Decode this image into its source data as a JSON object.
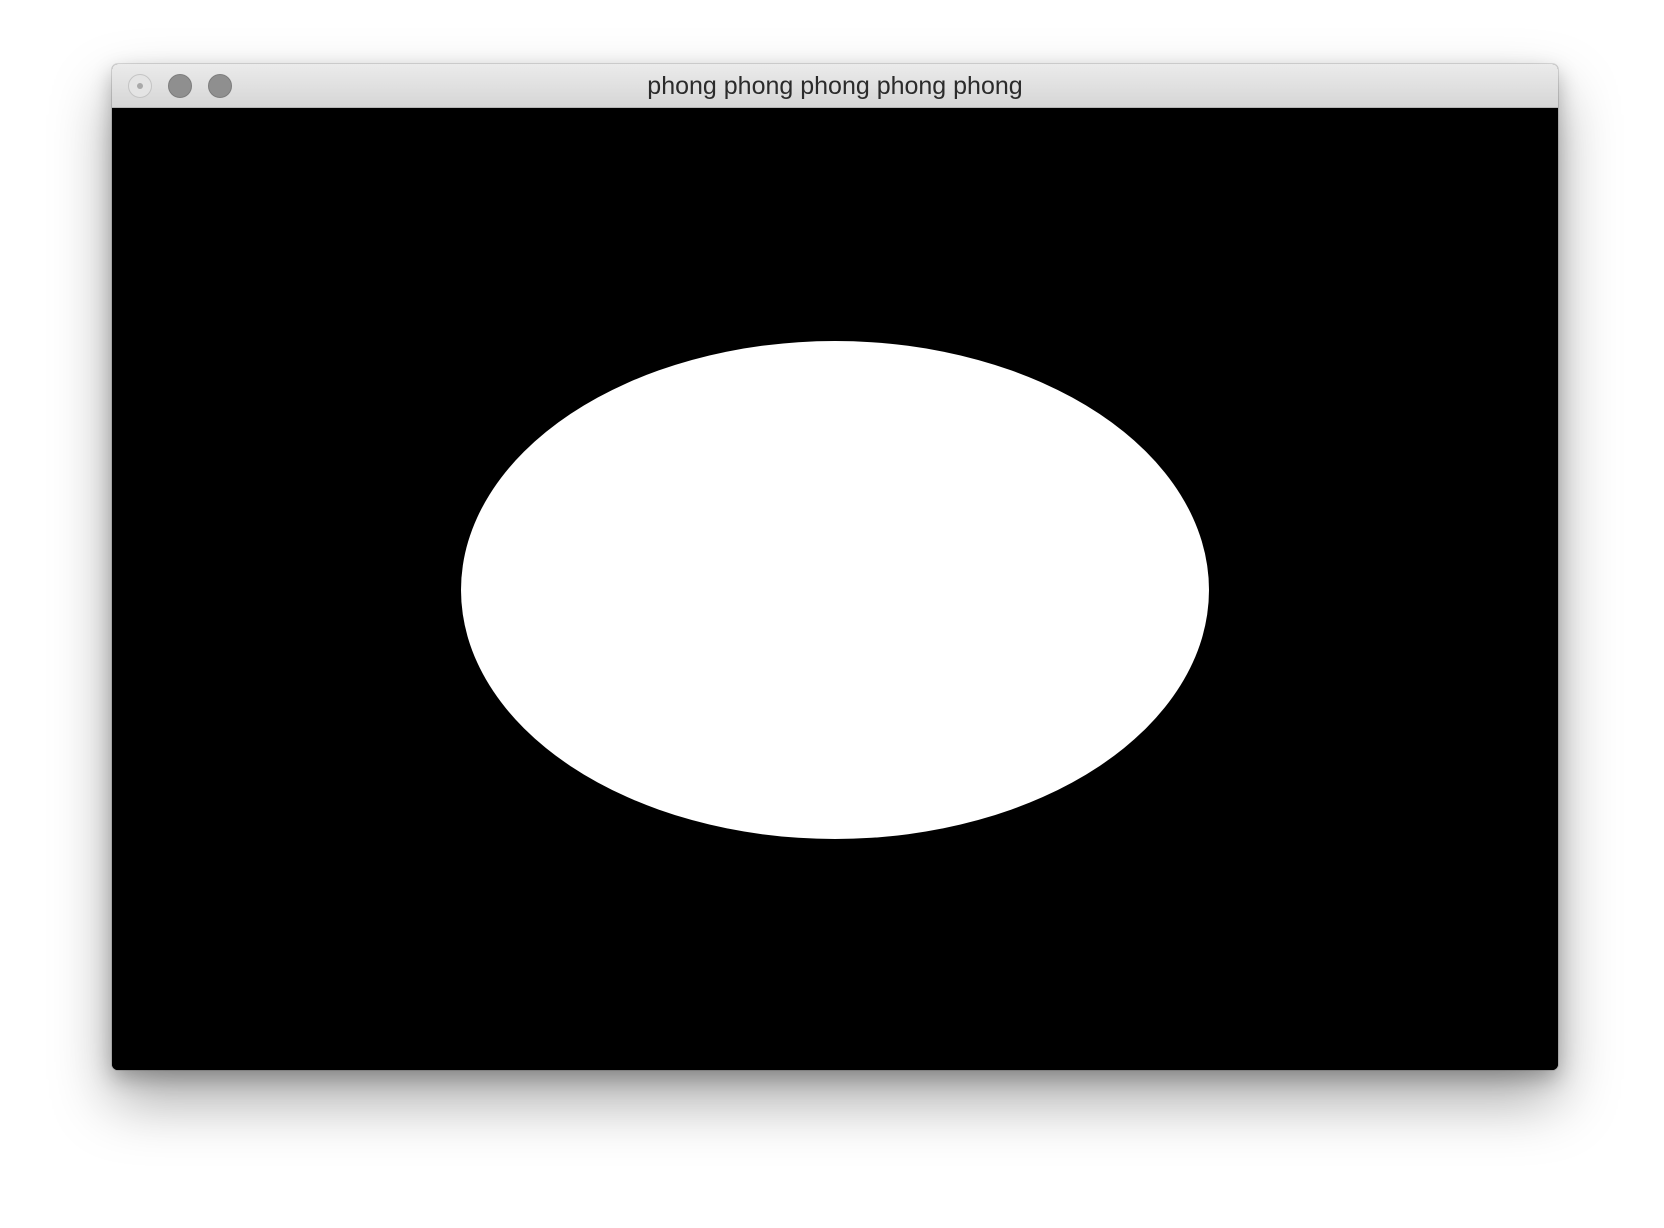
{
  "window": {
    "title": "phong phong phong phong phong"
  },
  "titlebar_buttons": {
    "close": "close-button",
    "minimize": "minimize-button",
    "zoom": "zoom-button"
  },
  "scene": {
    "background_color": "#000000",
    "shape_color": "#ffffff"
  },
  "colors": {
    "titlebar_gradient_top": "#ebebeb",
    "titlebar_gradient_bottom": "#d6d6d6",
    "traffic_inactive": "#8f8f8f"
  }
}
